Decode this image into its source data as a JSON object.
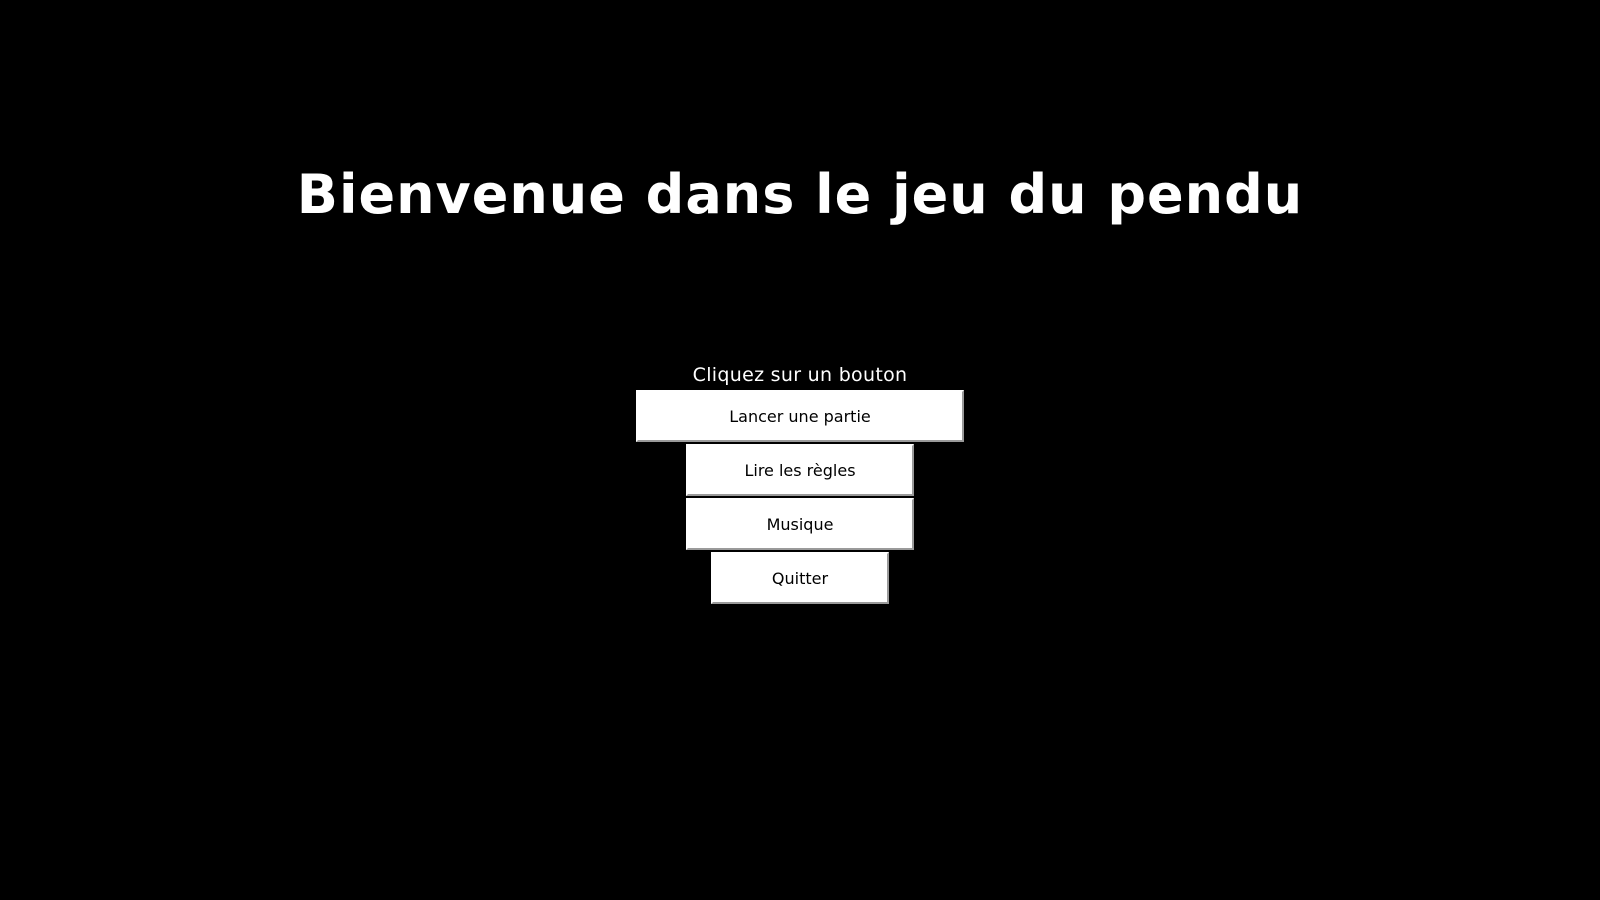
{
  "menu": {
    "title": "Bienvenue dans le jeu du pendu",
    "prompt": "Cliquez sur un bouton",
    "buttons": {
      "play": "Lancer une partie",
      "rules": "Lire les règles",
      "music": "Musique",
      "quit": "Quitter"
    }
  },
  "colors": {
    "background": "#000000",
    "title_text": "#ffffff",
    "button_bg": "#ffffff",
    "button_text": "#000000"
  }
}
